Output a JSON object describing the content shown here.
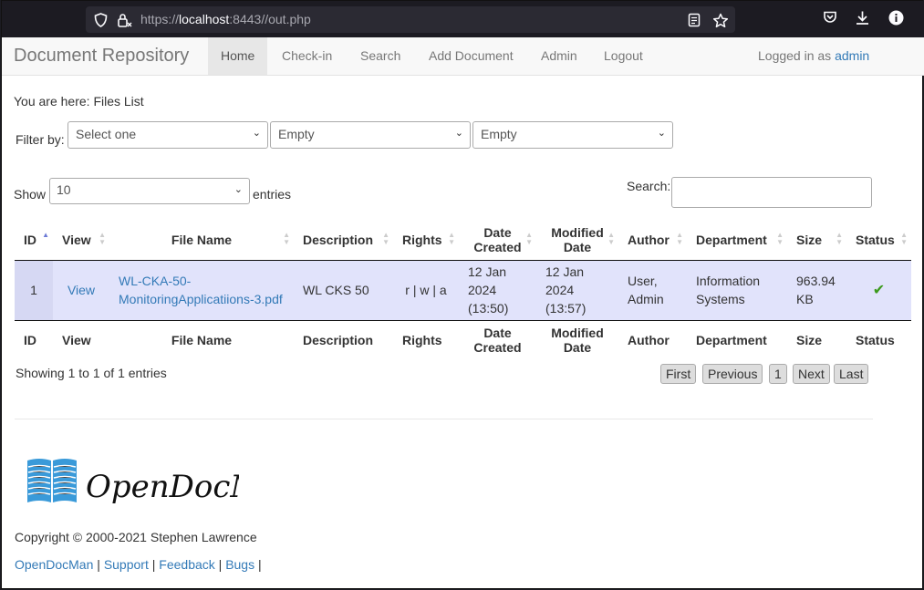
{
  "browser": {
    "url_prefix": "https://",
    "url_host": "localhost",
    "url_rest": ":8443//out.php"
  },
  "nav": {
    "brand": "Document Repository",
    "items": [
      "Home",
      "Check-in",
      "Search",
      "Add Document",
      "Admin",
      "Logout"
    ],
    "active": "Home",
    "logged_prefix": "Logged in as",
    "user": "admin"
  },
  "breadcrumb": "You are here: Files List",
  "filter": {
    "label": "Filter by:",
    "selects": [
      "Select one",
      "Empty",
      "Empty"
    ]
  },
  "entries": {
    "show_label": "Show",
    "value": "10",
    "suffix": "entries",
    "search_label": "Search:"
  },
  "table": {
    "headers": [
      "ID",
      "View",
      "File Name",
      "Description",
      "Rights",
      "Date Created",
      "Modified Date",
      "Author",
      "Department",
      "Size",
      "Status"
    ],
    "header_lines": {
      "date_created": [
        "Date",
        "Created"
      ],
      "modified_date": [
        "Modified",
        "Date"
      ]
    },
    "rows": [
      {
        "id": "1",
        "view": "View",
        "file_name": "WL-CKA-50-MonitoringApplicatiions-3.pdf",
        "file_name_lines": [
          "WL-CKA-50-",
          "MonitoringApplicatiions-3.pdf"
        ],
        "description": "WL CKS 50",
        "rights": "r | w | a",
        "date_created": [
          "12 Jan",
          "2024",
          "(13:50)"
        ],
        "modified_date": [
          "12 Jan",
          "2024",
          "(13:57)"
        ],
        "author": [
          "User,",
          "Admin"
        ],
        "department": [
          "Information",
          "Systems"
        ],
        "size": [
          "963.94",
          "KB"
        ],
        "status_icon": "check-icon"
      }
    ]
  },
  "pagination": {
    "info": "Showing 1 to 1 of 1 entries",
    "buttons": [
      "First",
      "Previous",
      "1",
      "Next",
      "Last"
    ]
  },
  "footer": {
    "logo_text": "OpenDocMan",
    "copyright": "Copyright © 2000-2021 Stephen Lawrence",
    "links": [
      "OpenDocMan",
      "Support",
      "Feedback",
      "Bugs"
    ]
  }
}
